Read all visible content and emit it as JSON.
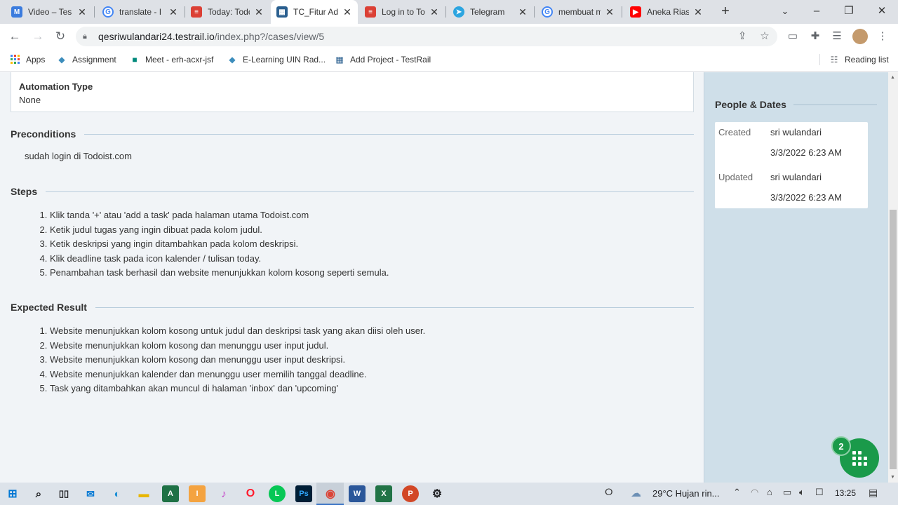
{
  "browser": {
    "tabs": [
      {
        "label": "Video – Tes",
        "icon": "m-letter-icon",
        "color": "#3b7cde"
      },
      {
        "label": "translate - I",
        "icon": "google-icon",
        "color": "#4285f4"
      },
      {
        "label": "Today: Todo",
        "icon": "todoist-icon",
        "color": "#db4035"
      },
      {
        "label": "TC_Fitur Ad",
        "icon": "testrail-icon",
        "color": "#2a5f8f"
      },
      {
        "label": "Log in to To",
        "icon": "todoist-icon",
        "color": "#db4035"
      },
      {
        "label": "Telegram",
        "icon": "telegram-icon",
        "color": "#2ca5e0"
      },
      {
        "label": "membuat m",
        "icon": "google-icon",
        "color": "#4285f4"
      },
      {
        "label": "Aneka Rias",
        "icon": "youtube-icon",
        "color": "#ff0000"
      }
    ],
    "url_main": "qesriwulandari24.testrail.io",
    "url_path": "/index.php?/cases/view/5",
    "bookmarks": [
      {
        "label": "Apps"
      },
      {
        "label": "Assignment"
      },
      {
        "label": "Meet - erh-acxr-jsf"
      },
      {
        "label": "E-Learning UIN Rad..."
      },
      {
        "label": "Add Project - TestRail"
      }
    ],
    "reading_list": "Reading list"
  },
  "automation": {
    "label": "Automation Type",
    "value": "None"
  },
  "preconditions": {
    "title": "Preconditions",
    "text": "sudah login di Todoist.com"
  },
  "steps": {
    "title": "Steps",
    "items": [
      "Klik tanda '+' atau 'add a task' pada halaman utama Todoist.com",
      "Ketik judul tugas yang ingin dibuat pada kolom judul.",
      "Ketik deskripsi yang ingin ditambahkan pada kolom deskripsi.",
      "Klik deadline task pada icon kalender / tulisan today.",
      "Penambahan task berhasil dan website menunjukkan kolom kosong seperti semula."
    ]
  },
  "expected": {
    "title": "Expected Result",
    "items": [
      "Website menunjukkan kolom kosong untuk judul dan deskripsi task yang akan diisi oleh user.",
      "Website menunjukkan kolom kosong dan menunggu user input judul.",
      "Website menunjukkan kolom kosong dan menunggu user input deskripsi.",
      "Website menunjukkan kalender dan menunggu user memilih tanggal deadline.",
      "Task yang ditambahkan akan muncul di halaman 'inbox' dan 'upcoming'"
    ]
  },
  "people_dates": {
    "title": "People & Dates",
    "created_label": "Created",
    "created_by": "sri wulandari",
    "created_at": "3/3/2022 6:23 AM",
    "updated_label": "Updated",
    "updated_by": "sri wulandari",
    "updated_at": "3/3/2022 6:23 AM"
  },
  "fab": {
    "badge": "2"
  },
  "taskbar": {
    "weather": "29°C  Hujan rin...",
    "time": "13:25"
  },
  "colors": {
    "page_bg": "#f1f4f7",
    "sidebar_bg": "#cfdfe9",
    "fab": "#1a9a4a",
    "rule": "#b9cddd"
  }
}
